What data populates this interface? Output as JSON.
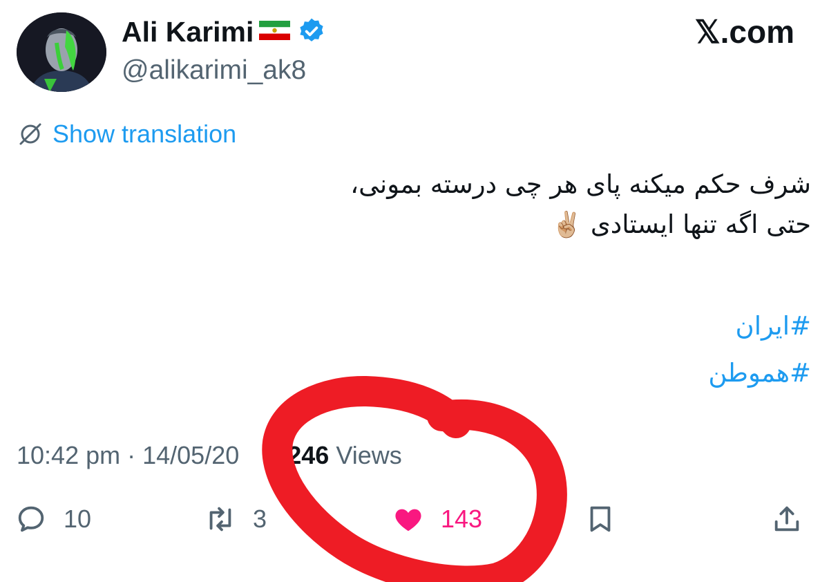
{
  "tweet": {
    "author": {
      "display_name": "Ali Karimi",
      "handle": "@alikarimi_ak8",
      "verified": true
    },
    "site_logo": "𝕏.com",
    "translate_label": "Show translation",
    "text_lines": [
      "شرف حکم میکنه پای هر چی درسته بمونی،",
      "حتی اگه تنها ایستادی"
    ],
    "text_emoji": "✌🏼",
    "hashtags": [
      "#ایران",
      "#هموطن"
    ],
    "time": "10:42 pm",
    "date_visible": "14/05/20",
    "views_count": "246",
    "views_label": "Views",
    "actions": {
      "reply_count": "10",
      "retweet_count_visible": "3",
      "like_count": "143"
    }
  },
  "colors": {
    "link_blue": "#1d9bf0",
    "muted_gray": "#536471",
    "like_pink": "#f91880",
    "annotation_red": "#ee1c25"
  },
  "icons": [
    "flag-icon",
    "verified-badge-icon",
    "translate-icon",
    "reply-icon",
    "retweet-icon",
    "heart-icon",
    "bookmark-icon",
    "share-icon"
  ]
}
